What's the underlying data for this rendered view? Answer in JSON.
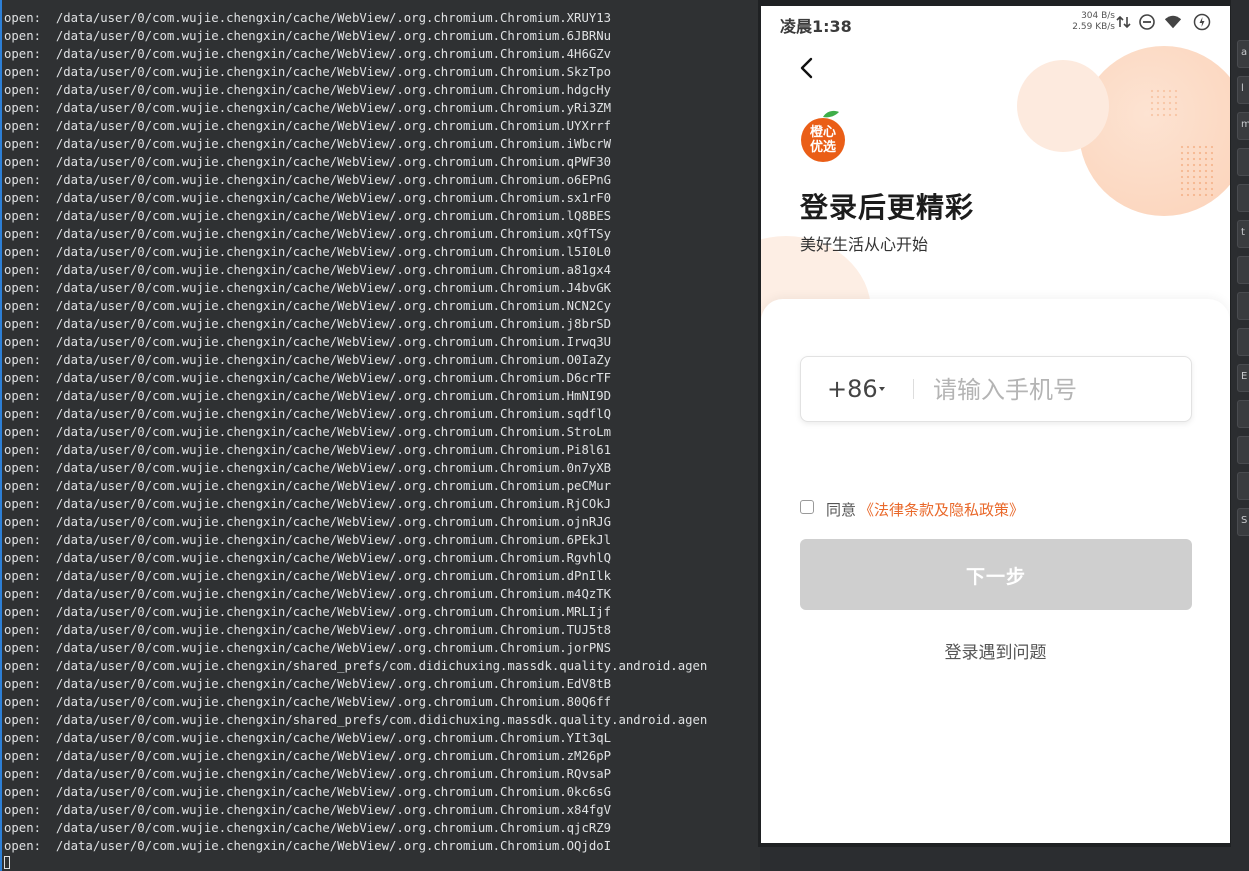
{
  "terminal": {
    "lines": [
      "open:  /data/user/0/com.wujie.chengxin/cache/WebView/.org.chromium.Chromium.XRUY13",
      "open:  /data/user/0/com.wujie.chengxin/cache/WebView/.org.chromium.Chromium.6JBRNu",
      "open:  /data/user/0/com.wujie.chengxin/cache/WebView/.org.chromium.Chromium.4H6GZv",
      "open:  /data/user/0/com.wujie.chengxin/cache/WebView/.org.chromium.Chromium.SkzTpo",
      "open:  /data/user/0/com.wujie.chengxin/cache/WebView/.org.chromium.Chromium.hdgcHy",
      "open:  /data/user/0/com.wujie.chengxin/cache/WebView/.org.chromium.Chromium.yRi3ZM",
      "open:  /data/user/0/com.wujie.chengxin/cache/WebView/.org.chromium.Chromium.UYXrrf",
      "open:  /data/user/0/com.wujie.chengxin/cache/WebView/.org.chromium.Chromium.iWbcrW",
      "open:  /data/user/0/com.wujie.chengxin/cache/WebView/.org.chromium.Chromium.qPWF30",
      "open:  /data/user/0/com.wujie.chengxin/cache/WebView/.org.chromium.Chromium.o6EPnG",
      "open:  /data/user/0/com.wujie.chengxin/cache/WebView/.org.chromium.Chromium.sx1rF0",
      "open:  /data/user/0/com.wujie.chengxin/cache/WebView/.org.chromium.Chromium.lQ8BES",
      "open:  /data/user/0/com.wujie.chengxin/cache/WebView/.org.chromium.Chromium.xQfTSy",
      "open:  /data/user/0/com.wujie.chengxin/cache/WebView/.org.chromium.Chromium.l5I0L0",
      "open:  /data/user/0/com.wujie.chengxin/cache/WebView/.org.chromium.Chromium.a81gx4",
      "open:  /data/user/0/com.wujie.chengxin/cache/WebView/.org.chromium.Chromium.J4bvGK",
      "open:  /data/user/0/com.wujie.chengxin/cache/WebView/.org.chromium.Chromium.NCN2Cy",
      "open:  /data/user/0/com.wujie.chengxin/cache/WebView/.org.chromium.Chromium.j8brSD",
      "open:  /data/user/0/com.wujie.chengxin/cache/WebView/.org.chromium.Chromium.Irwq3U",
      "open:  /data/user/0/com.wujie.chengxin/cache/WebView/.org.chromium.Chromium.O0IaZy",
      "open:  /data/user/0/com.wujie.chengxin/cache/WebView/.org.chromium.Chromium.D6crTF",
      "open:  /data/user/0/com.wujie.chengxin/cache/WebView/.org.chromium.Chromium.HmNI9D",
      "open:  /data/user/0/com.wujie.chengxin/cache/WebView/.org.chromium.Chromium.sqdflQ",
      "open:  /data/user/0/com.wujie.chengxin/cache/WebView/.org.chromium.Chromium.StroLm",
      "open:  /data/user/0/com.wujie.chengxin/cache/WebView/.org.chromium.Chromium.Pi8l61",
      "open:  /data/user/0/com.wujie.chengxin/cache/WebView/.org.chromium.Chromium.0n7yXB",
      "open:  /data/user/0/com.wujie.chengxin/cache/WebView/.org.chromium.Chromium.peCMur",
      "open:  /data/user/0/com.wujie.chengxin/cache/WebView/.org.chromium.Chromium.RjCOkJ",
      "open:  /data/user/0/com.wujie.chengxin/cache/WebView/.org.chromium.Chromium.ojnRJG",
      "open:  /data/user/0/com.wujie.chengxin/cache/WebView/.org.chromium.Chromium.6PEkJl",
      "open:  /data/user/0/com.wujie.chengxin/cache/WebView/.org.chromium.Chromium.RgvhlQ",
      "open:  /data/user/0/com.wujie.chengxin/cache/WebView/.org.chromium.Chromium.dPnIlk",
      "open:  /data/user/0/com.wujie.chengxin/cache/WebView/.org.chromium.Chromium.m4QzTK",
      "open:  /data/user/0/com.wujie.chengxin/cache/WebView/.org.chromium.Chromium.MRLIjf",
      "open:  /data/user/0/com.wujie.chengxin/cache/WebView/.org.chromium.Chromium.TUJ5t8",
      "open:  /data/user/0/com.wujie.chengxin/cache/WebView/.org.chromium.Chromium.jorPNS",
      "open:  /data/user/0/com.wujie.chengxin/shared_prefs/com.didichuxing.massdk.quality.android.agen",
      "open:  /data/user/0/com.wujie.chengxin/cache/WebView/.org.chromium.Chromium.EdV8tB",
      "open:  /data/user/0/com.wujie.chengxin/cache/WebView/.org.chromium.Chromium.80Q6ff",
      "open:  /data/user/0/com.wujie.chengxin/shared_prefs/com.didichuxing.massdk.quality.android.agen",
      "open:  /data/user/0/com.wujie.chengxin/cache/WebView/.org.chromium.Chromium.YIt3qL",
      "open:  /data/user/0/com.wujie.chengxin/cache/WebView/.org.chromium.Chromium.zM26pP",
      "open:  /data/user/0/com.wujie.chengxin/cache/WebView/.org.chromium.Chromium.RQvsaP",
      "open:  /data/user/0/com.wujie.chengxin/cache/WebView/.org.chromium.Chromium.0kc6sG",
      "open:  /data/user/0/com.wujie.chengxin/cache/WebView/.org.chromium.Chromium.x84fgV",
      "open:  /data/user/0/com.wujie.chengxin/cache/WebView/.org.chromium.Chromium.qjcRZ9",
      "open:  /data/user/0/com.wujie.chengxin/cache/WebView/.org.chromium.Chromium.OQjdoI"
    ]
  },
  "phone": {
    "status": {
      "time": "凌晨1:38",
      "net_up": "304 B/s",
      "net_down": "2.59 KB/s",
      "icons": [
        "data-arrows-icon",
        "dnd-icon",
        "wifi-icon",
        "battery-icon"
      ]
    },
    "logo_text_top": "橙心",
    "logo_text_bottom": "优选",
    "headline": "登录后更精彩",
    "subhead": "美好生活从心开始",
    "country_code": "+86",
    "phone_placeholder": "请输入手机号",
    "agree_prefix": "同意",
    "agree_link": "《法律条款及隐私政策》",
    "next_button": "下一步",
    "help_link": "登录遇到问题",
    "accent_color": "#e9692b"
  },
  "side_strip": {
    "labels": [
      "a",
      "l",
      "m",
      "",
      "",
      "t",
      "",
      "",
      "",
      "E",
      "",
      "",
      "",
      "S"
    ]
  }
}
